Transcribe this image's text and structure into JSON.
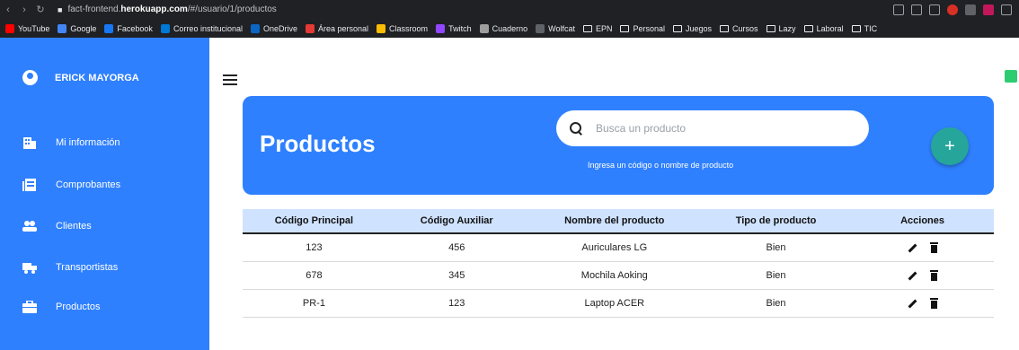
{
  "browser": {
    "url_prefix": "fact-frontend.",
    "url_domain": "herokuapp.com",
    "url_path": "/#/usuario/1/productos",
    "bookmarks": [
      {
        "label": "YouTube",
        "color": "#ff0000",
        "type": "site"
      },
      {
        "label": "Google",
        "color": "#4285f4",
        "type": "site"
      },
      {
        "label": "Facebook",
        "color": "#1877f2",
        "type": "site"
      },
      {
        "label": "Correo institucional",
        "color": "#0078d4",
        "type": "site"
      },
      {
        "label": "OneDrive",
        "color": "#0a66c2",
        "type": "site"
      },
      {
        "label": "Área personal",
        "color": "#e53935",
        "type": "site"
      },
      {
        "label": "Classroom",
        "color": "#fbbc04",
        "type": "site"
      },
      {
        "label": "Twitch",
        "color": "#9146ff",
        "type": "site"
      },
      {
        "label": "Cuaderno",
        "color": "#9e9e9e",
        "type": "site"
      },
      {
        "label": "Wolfcat",
        "color": "#5f6368",
        "type": "site"
      },
      {
        "label": "EPN",
        "type": "folder"
      },
      {
        "label": "Personal",
        "type": "folder"
      },
      {
        "label": "Juegos",
        "type": "folder"
      },
      {
        "label": "Cursos",
        "type": "folder"
      },
      {
        "label": "Lazy",
        "type": "folder"
      },
      {
        "label": "Laboral",
        "type": "folder"
      },
      {
        "label": "TIC",
        "type": "folder"
      }
    ]
  },
  "sidebar": {
    "user_name": "ERICK MAYORGA",
    "items": [
      {
        "label": "Mi información",
        "icon": "building-icon"
      },
      {
        "label": "Comprobantes",
        "icon": "receipt-icon"
      },
      {
        "label": "Clientes",
        "icon": "users-icon"
      },
      {
        "label": "Transportistas",
        "icon": "truck-icon"
      },
      {
        "label": "Productos",
        "icon": "briefcase-icon"
      }
    ],
    "color": "#2f80ff"
  },
  "header": {
    "title": "Productos",
    "search_placeholder": "Busca un producto",
    "search_hint": "Ingresa un código o nombre de producto",
    "add_label": "+",
    "accent": "#26a69a"
  },
  "table": {
    "columns": [
      "Código Principal",
      "Código Auxiliar",
      "Nombre del producto",
      "Tipo de producto",
      "Acciones"
    ],
    "rows": [
      [
        "123",
        "456",
        "Auriculares LG",
        "Bien"
      ],
      [
        "678",
        "345",
        "Mochila Aoking",
        "Bien"
      ],
      [
        "PR-1",
        "123",
        "Laptop ACER",
        "Bien"
      ]
    ]
  }
}
